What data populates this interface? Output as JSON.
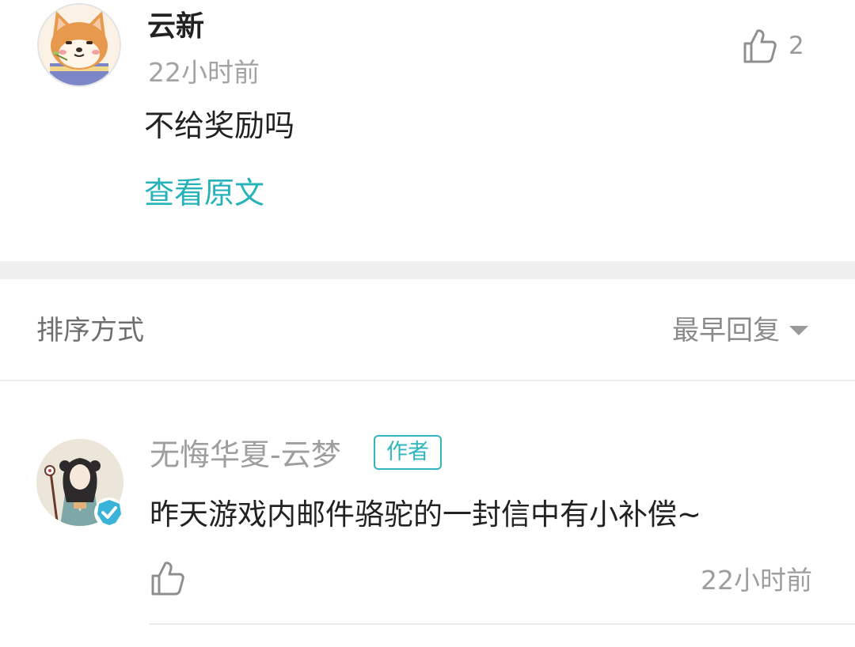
{
  "comment": {
    "username": "云新",
    "time": "22小时前",
    "likes": "2",
    "text": "不给奖励吗",
    "view_original": "查看原文",
    "avatar_icon": "shiba-dog-avatar",
    "like_icon": "thumbs-up-icon"
  },
  "sort": {
    "label": "排序方式",
    "value": "最早回复",
    "caret_icon": "caret-down-icon"
  },
  "reply": {
    "username": "无悔华夏-云梦",
    "badge": "作者",
    "text": "昨天游戏内邮件骆驼的一封信中有小补偿~",
    "time": "22小时前",
    "avatar_icon": "character-avatar",
    "verified_icon": "verified-check-icon",
    "like_icon": "thumbs-up-icon"
  },
  "colors": {
    "accent": "#25b2b8",
    "text_primary": "#222222",
    "text_secondary": "#9e9e9e",
    "divider": "#efefef"
  }
}
